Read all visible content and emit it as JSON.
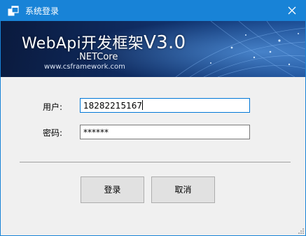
{
  "window": {
    "title": "系统登录",
    "close_icon": "close-icon",
    "app_icon": "app-window-icon",
    "titlebar_color": "#1883d7"
  },
  "banner": {
    "title": "WebApi开发框架",
    "version": "V3.0",
    "subtitle": ".NETCore",
    "url": "www.csframework.com"
  },
  "form": {
    "username_label": "用户:",
    "username_value": "18282215167",
    "password_label": "密码:",
    "password_value": "******"
  },
  "buttons": {
    "login_label": "登录",
    "cancel_label": "取消"
  }
}
